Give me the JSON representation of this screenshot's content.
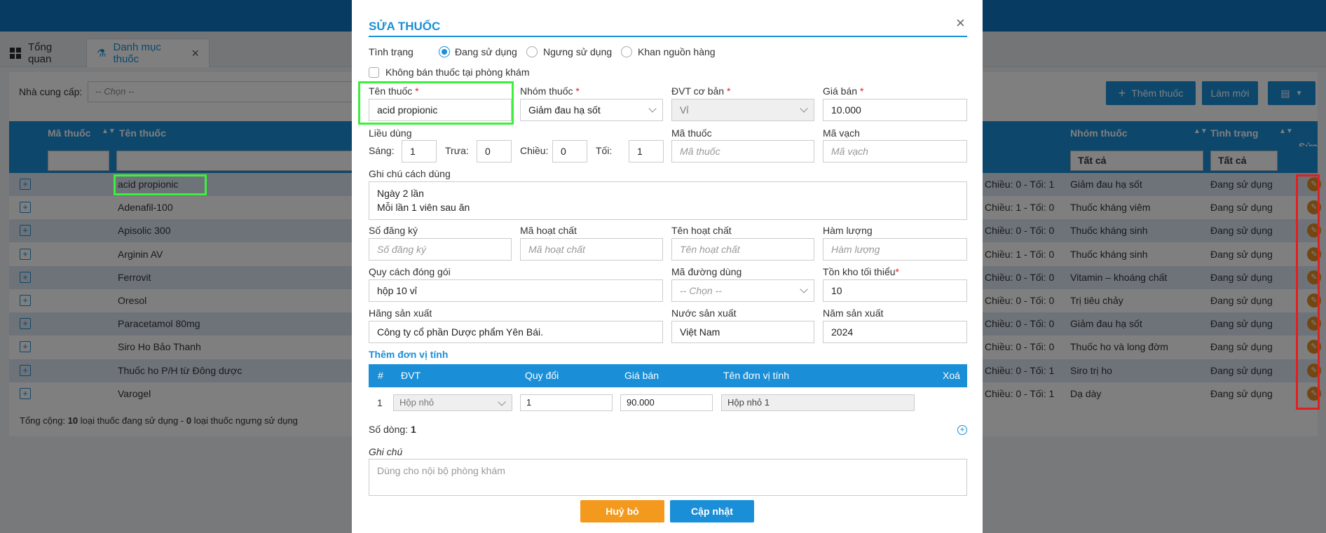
{
  "tabs": [
    {
      "label": "Tổng quan",
      "icon": "grid-icon"
    },
    {
      "label": "Danh mục thuốc",
      "icon": "drug-icon"
    }
  ],
  "filter": {
    "label": "Nhà cung cấp:",
    "placeholder": "-- Chọn --"
  },
  "toolbar": {
    "add_label": "Thêm thuốc",
    "refresh_label": "Làm mới"
  },
  "table": {
    "headers": {
      "code": "Mã thuốc",
      "name": "Tên thuốc",
      "group": "Nhóm thuốc",
      "status": "Tình trạng",
      "edit": "Sửa"
    },
    "filters": {
      "group": "Tất cả",
      "status": "Tất cả"
    },
    "rows": [
      {
        "name": "acid propionic",
        "dose": "Chiều: 0 - Tối: 1",
        "group": "Giảm đau hạ sốt",
        "status": "Đang sử dụng"
      },
      {
        "name": "Adenafil-100",
        "dose": "Chiều: 1 - Tối: 0",
        "group": "Thuốc kháng viêm",
        "status": "Đang sử dụng"
      },
      {
        "name": "Apisolic 300",
        "dose": "Chiều: 0 - Tối: 0",
        "group": "Thuốc kháng sinh",
        "status": "Đang sử dụng"
      },
      {
        "name": "Arginin AV",
        "dose": "Chiều: 1 - Tối: 0",
        "group": "Thuốc kháng sinh",
        "status": "Đang sử dụng"
      },
      {
        "name": "Ferrovit",
        "dose": "Chiều: 0 - Tối: 0",
        "group": "Vitamin – khoáng chất",
        "status": "Đang sử dụng"
      },
      {
        "name": "Oresol",
        "dose": "Chiều: 0 - Tối: 0",
        "group": "Trị tiêu chảy",
        "status": "Đang sử dụng"
      },
      {
        "name": "Paracetamol 80mg",
        "dose": "Chiều: 0 - Tối: 0",
        "group": "Giảm đau hạ sốt",
        "status": "Đang sử dụng"
      },
      {
        "name": "Siro Ho Bảo Thanh",
        "dose": "Chiều: 0 - Tối: 0",
        "group": "Thuốc ho và long đờm",
        "status": "Đang sử dụng"
      },
      {
        "name": "Thuốc ho P/H từ Đông dược",
        "dose": "Chiều: 0 - Tối: 1",
        "group": "Siro trị ho",
        "status": "Đang sử dụng"
      },
      {
        "name": "Varogel",
        "dose": "Chiều: 0 - Tối: 1",
        "group": "Dạ dày",
        "status": "Đang sử dụng"
      }
    ],
    "footer": {
      "prefix": "Tổng cộng: ",
      "active_count": "10",
      "middle": " loại thuốc đang sử dụng - ",
      "inactive_count": "0",
      "suffix": " loại thuốc ngưng sử dụng"
    }
  },
  "modal": {
    "title": "SỬA THUỐC",
    "status_label": "Tình trạng",
    "status_options": [
      "Đang sử dụng",
      "Ngưng sử dụng",
      "Khan nguồn hàng"
    ],
    "status_selected": "Đang sử dụng",
    "no_sale_label": "Không bán thuốc tại phòng khám",
    "name_label": "Tên thuốc",
    "name_value": "acid propionic",
    "group_label": "Nhóm thuốc",
    "group_value": "Giảm đau hạ sốt",
    "unit_label": "ĐVT cơ bản",
    "unit_value": "Vỉ",
    "price_label": "Giá bán",
    "price_value": "10.000",
    "dosage_label": "Liều dùng",
    "morning_label": "Sáng:",
    "morning_value": "1",
    "noon_label": "Trưa:",
    "noon_value": "0",
    "afternoon_label": "Chiều:",
    "afternoon_value": "0",
    "night_label": "Tối:",
    "night_value": "1",
    "code_label": "Mã thuốc",
    "code_placeholder": "Mã thuốc",
    "barcode_label": "Mã vạch",
    "barcode_placeholder": "Mã vạch",
    "usage_note_label": "Ghi chú cách dùng",
    "usage_note_line1": "Ngày 2 lần",
    "usage_note_line2": "Mỗi lần 1 viên sau ăn",
    "reg_label": "Số đăng ký",
    "reg_placeholder": "Số đăng ký",
    "active_code_label": "Mã hoạt chất",
    "active_code_placeholder": "Mã hoạt chất",
    "active_name_label": "Tên hoạt chất",
    "active_name_placeholder": "Tên hoạt chất",
    "content_label": "Hàm lượng",
    "content_placeholder": "Hàm lượng",
    "packing_label": "Quy cách đóng gói",
    "packing_value": "hộp 10 vỉ",
    "route_label": "Mã đường dùng",
    "route_placeholder": "-- Chọn --",
    "min_stock_label": "Tồn kho tối thiểu",
    "min_stock_value": "10",
    "maker_label": "Hãng sản xuất",
    "maker_value": "Công ty cổ phần Dược phẩm Yên Bái.",
    "country_label": "Nước sản xuất",
    "country_value": "Việt Nam",
    "year_label": "Năm sản xuất",
    "year_value": "2024",
    "add_unit_label": "Thêm đơn vị tính",
    "unit_table_headers": [
      "#",
      "ĐVT",
      "Quy đổi",
      "Giá bán",
      "Tên đơn vị tính",
      "Xoá"
    ],
    "unit_rows": [
      {
        "index": "1",
        "unit": "Hộp nhỏ",
        "ratio": "1",
        "price": "90.000",
        "name": "Hộp nhỏ 1"
      }
    ],
    "rows_count_label": "Số dòng:",
    "rows_count_value": "1",
    "note_label": "Ghi chú",
    "note_placeholder": "Dùng cho nội bộ phòng khám",
    "cancel_label": "Huỷ bỏ",
    "update_label": "Cập nhật"
  },
  "colors": {
    "primary": "#1a8fd8",
    "cancel": "#f39a1e",
    "edit_icon": "#e58e26",
    "highlight_green": "#3cf03c",
    "highlight_red": "#e02020"
  }
}
